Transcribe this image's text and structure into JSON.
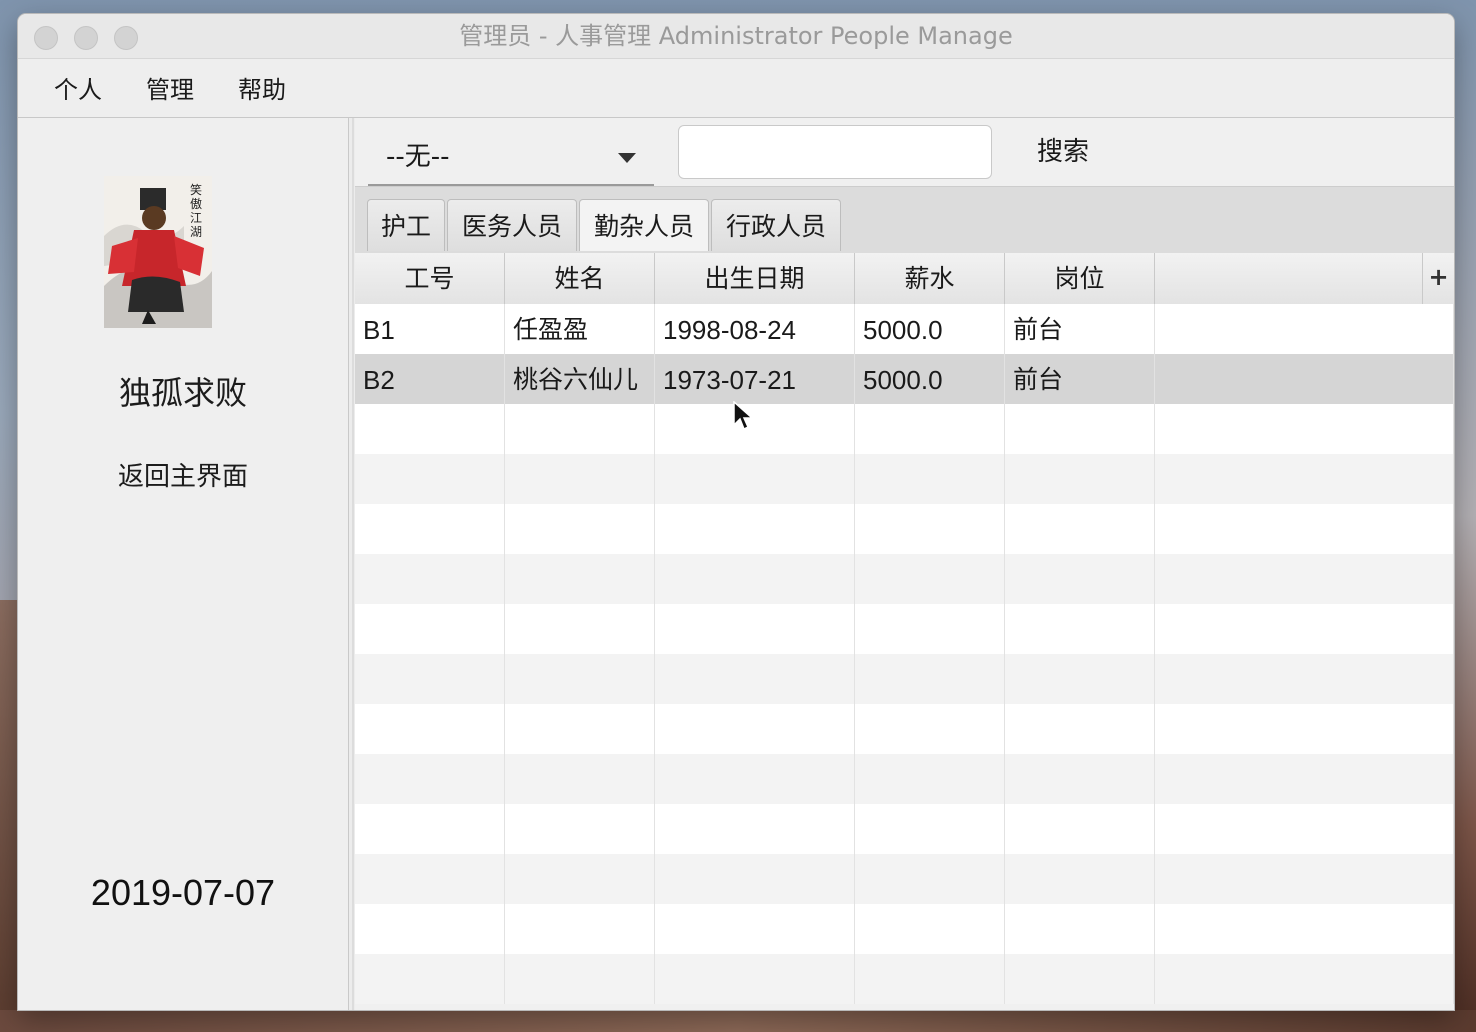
{
  "window": {
    "title": "管理员 - 人事管理 Administrator People Manage"
  },
  "menu": {
    "items": [
      {
        "label": "个人"
      },
      {
        "label": "管理"
      },
      {
        "label": "帮助"
      }
    ]
  },
  "sidebar": {
    "user_name": "独孤求败",
    "back_label": "返回主界面",
    "date": "2019-07-07",
    "avatar_icon": "user-avatar-illustration"
  },
  "search": {
    "filter_value": "--无--",
    "query_value": "",
    "button_label": "搜索"
  },
  "tabs": [
    {
      "label": "护工",
      "active": false
    },
    {
      "label": "医务人员",
      "active": false
    },
    {
      "label": "勤杂人员",
      "active": true
    },
    {
      "label": "行政人员",
      "active": false
    }
  ],
  "table": {
    "columns": [
      "工号",
      "姓名",
      "出生日期",
      "薪水",
      "岗位"
    ],
    "add_column_label": "+",
    "rows": [
      [
        "B1",
        "任盈盈",
        "1998-08-24",
        "5000.0",
        "前台"
      ],
      [
        "B2",
        "桃谷六仙儿",
        "1973-07-21",
        "5000.0",
        "前台"
      ]
    ],
    "selected_row": 1
  },
  "colors": {
    "window_bg": "#ececec",
    "selected_row": "#d5d5d5",
    "title_text": "#9a9a9a"
  }
}
